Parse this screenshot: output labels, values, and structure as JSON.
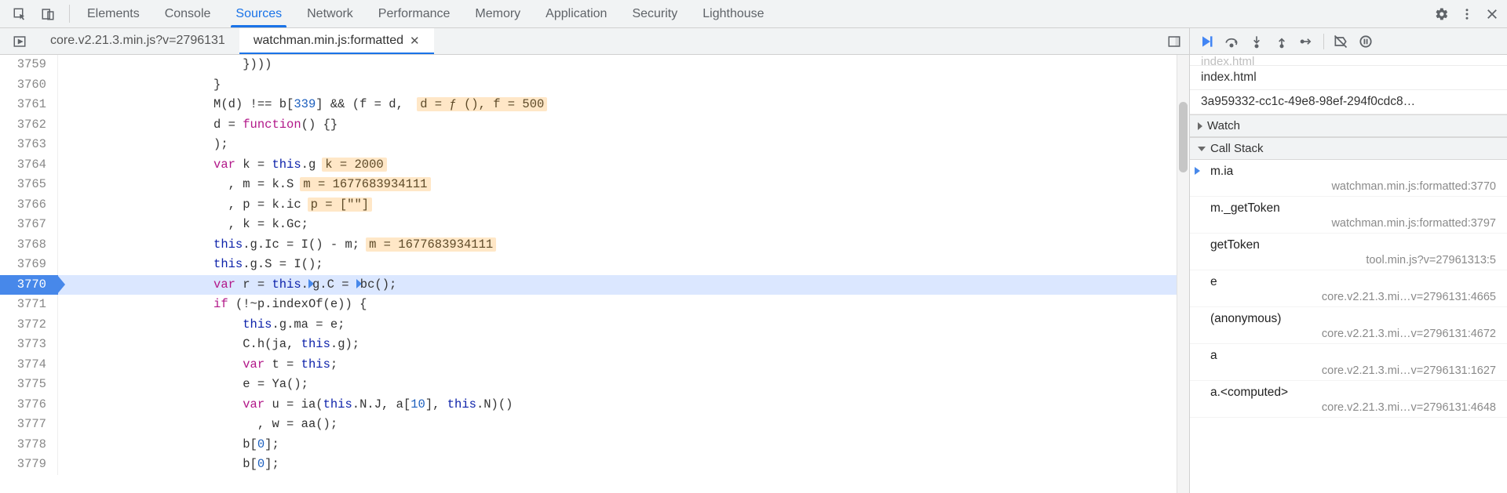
{
  "toolbar": {
    "panels": [
      "Elements",
      "Console",
      "Sources",
      "Network",
      "Performance",
      "Memory",
      "Application",
      "Security",
      "Lighthouse"
    ],
    "active_panel": "Sources"
  },
  "file_tabs": {
    "tabs": [
      {
        "label": "core.v2.21.3.min.js?v=2796131",
        "active": false,
        "closable": false
      },
      {
        "label": "watchman.min.js:formatted",
        "active": true,
        "closable": true
      }
    ]
  },
  "editor": {
    "first_line": 3759,
    "exec_line": 3770,
    "lines": [
      {
        "n": 3759,
        "indent": 24,
        "segs": [
          {
            "t": "})))",
            "c": "tok-text"
          }
        ]
      },
      {
        "n": 3760,
        "indent": 20,
        "segs": [
          {
            "t": "}",
            "c": "tok-text"
          }
        ]
      },
      {
        "n": 3761,
        "indent": 20,
        "segs": [
          {
            "t": "M(d) !== b[",
            "c": "tok-text"
          },
          {
            "t": "339",
            "c": "tok-num"
          },
          {
            "t": "] && (f = d, ",
            "c": "tok-text"
          }
        ],
        "inline": "d = ƒ (), f = 500"
      },
      {
        "n": 3762,
        "indent": 20,
        "segs": [
          {
            "t": "d = ",
            "c": "tok-text"
          },
          {
            "t": "function",
            "c": "tok-kw"
          },
          {
            "t": "() {}",
            "c": "tok-text"
          }
        ]
      },
      {
        "n": 3763,
        "indent": 20,
        "segs": [
          {
            "t": ");",
            "c": "tok-text"
          }
        ]
      },
      {
        "n": 3764,
        "indent": 20,
        "segs": [
          {
            "t": "var",
            "c": "tok-kw"
          },
          {
            "t": " k = ",
            "c": "tok-text"
          },
          {
            "t": "this",
            "c": "tok-this"
          },
          {
            "t": ".g",
            "c": "tok-text"
          }
        ],
        "inline": "k = 2000"
      },
      {
        "n": 3765,
        "indent": 22,
        "segs": [
          {
            "t": ", m = k.S",
            "c": "tok-text"
          }
        ],
        "inline": "m = 1677683934111"
      },
      {
        "n": 3766,
        "indent": 22,
        "segs": [
          {
            "t": ", p = k.ic",
            "c": "tok-text"
          }
        ],
        "inline": "p = [\"\"]"
      },
      {
        "n": 3767,
        "indent": 22,
        "segs": [
          {
            "t": ", k = k.Gc;",
            "c": "tok-text"
          }
        ]
      },
      {
        "n": 3768,
        "indent": 20,
        "segs": [
          {
            "t": "this",
            "c": "tok-this"
          },
          {
            "t": ".g.Ic = I() - m;",
            "c": "tok-text"
          }
        ],
        "inline": "m = 1677683934111"
      },
      {
        "n": 3769,
        "indent": 20,
        "segs": [
          {
            "t": "this",
            "c": "tok-this"
          },
          {
            "t": ".g.S = I();",
            "c": "tok-text"
          }
        ]
      },
      {
        "n": 3770,
        "indent": 20,
        "exec": true,
        "segs": [
          {
            "t": "var",
            "c": "tok-kw"
          },
          {
            "t": " r = ",
            "c": "tok-text"
          },
          {
            "t": "this",
            "c": "tok-this"
          },
          {
            "t": ".",
            "c": "tok-text"
          },
          {
            "tri": true
          },
          {
            "t": "g.C = ",
            "c": "tok-text"
          },
          {
            "tri": true
          },
          {
            "t": "bc();",
            "c": "tok-text"
          }
        ]
      },
      {
        "n": 3771,
        "indent": 20,
        "segs": [
          {
            "t": "if",
            "c": "tok-kw"
          },
          {
            "t": " (!~p.indexOf(e)) {",
            "c": "tok-text"
          }
        ]
      },
      {
        "n": 3772,
        "indent": 24,
        "segs": [
          {
            "t": "this",
            "c": "tok-this"
          },
          {
            "t": ".g.ma = e;",
            "c": "tok-text"
          }
        ]
      },
      {
        "n": 3773,
        "indent": 24,
        "segs": [
          {
            "t": "C.h(ja, ",
            "c": "tok-text"
          },
          {
            "t": "this",
            "c": "tok-this"
          },
          {
            "t": ".g);",
            "c": "tok-text"
          }
        ]
      },
      {
        "n": 3774,
        "indent": 24,
        "segs": [
          {
            "t": "var",
            "c": "tok-kw"
          },
          {
            "t": " t = ",
            "c": "tok-text"
          },
          {
            "t": "this",
            "c": "tok-this"
          },
          {
            "t": ";",
            "c": "tok-text"
          }
        ]
      },
      {
        "n": 3775,
        "indent": 24,
        "segs": [
          {
            "t": "e = Ya();",
            "c": "tok-text"
          }
        ]
      },
      {
        "n": 3776,
        "indent": 24,
        "segs": [
          {
            "t": "var",
            "c": "tok-kw"
          },
          {
            "t": " u = ia(",
            "c": "tok-text"
          },
          {
            "t": "this",
            "c": "tok-this"
          },
          {
            "t": ".N.J, a[",
            "c": "tok-text"
          },
          {
            "t": "10",
            "c": "tok-num"
          },
          {
            "t": "], ",
            "c": "tok-text"
          },
          {
            "t": "this",
            "c": "tok-this"
          },
          {
            "t": ".N)()",
            "c": "tok-text"
          }
        ]
      },
      {
        "n": 3777,
        "indent": 26,
        "segs": [
          {
            "t": ", w = aa();",
            "c": "tok-text"
          }
        ]
      },
      {
        "n": 3778,
        "indent": 24,
        "segs": [
          {
            "t": "b[",
            "c": "tok-text"
          },
          {
            "t": "0",
            "c": "tok-num"
          },
          {
            "t": "];",
            "c": "tok-text"
          }
        ]
      },
      {
        "n": 3779,
        "indent": 24,
        "segs": [
          {
            "t": "b[",
            "c": "tok-text"
          },
          {
            "t": "0",
            "c": "tok-num"
          },
          {
            "t": "];",
            "c": "tok-text"
          }
        ]
      }
    ]
  },
  "sidebar": {
    "truncated_row": "index.html",
    "rows": [
      "index.html",
      "3a959332-cc1c-49e8-98ef-294f0cdc8…"
    ],
    "watch_label": "Watch",
    "callstack_label": "Call Stack",
    "callstack": [
      {
        "fn": "m.ia",
        "loc": "watchman.min.js:formatted:3770",
        "current": true
      },
      {
        "fn": "m._getToken",
        "loc": "watchman.min.js:formatted:3797"
      },
      {
        "fn": "getToken",
        "loc": "tool.min.js?v=27961313:5"
      },
      {
        "fn": "e",
        "loc": "core.v2.21.3.mi…v=2796131:4665"
      },
      {
        "fn": "(anonymous)",
        "loc": "core.v2.21.3.mi…v=2796131:4672"
      },
      {
        "fn": "a",
        "loc": "core.v2.21.3.mi…v=2796131:1627"
      },
      {
        "fn": "a.<computed>",
        "loc": "core.v2.21.3.mi…v=2796131:4648"
      }
    ]
  }
}
